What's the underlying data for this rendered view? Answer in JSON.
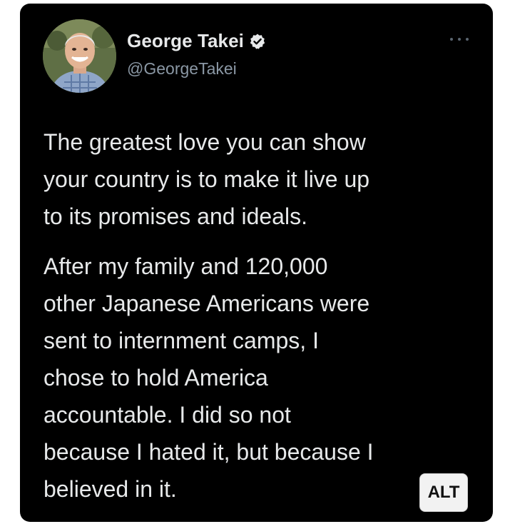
{
  "author": {
    "display_name": "George Takei",
    "handle": "@GeorgeTakei",
    "verified": true,
    "avatar_icon": "profile-photo"
  },
  "tweet": {
    "paragraph_1": "The greatest love you can show\nyour country is to make it live up\nto its promises and ideals.",
    "paragraph_2": "After my family and 120,000\nother Japanese Americans were\nsent to internment camps, I\nchose to hold America\naccountable. I did so not\nbecause I hated it, but because I\nbelieved in it."
  },
  "alt_badge": {
    "label": "ALT"
  },
  "colors": {
    "card_background": "#000000",
    "text_primary": "#e7e9ea",
    "text_secondary": "#8b98a5",
    "page_background": "#ffffff"
  }
}
